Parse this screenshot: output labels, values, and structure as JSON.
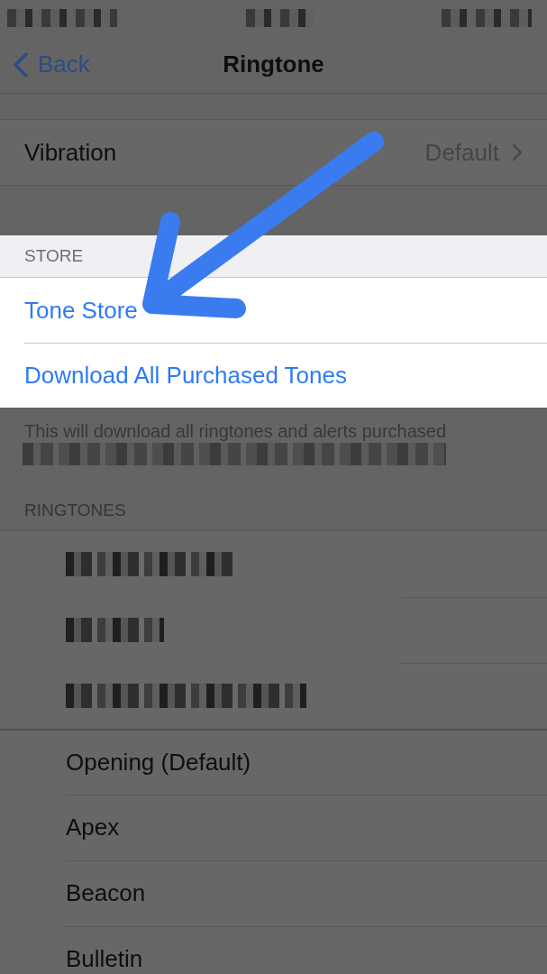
{
  "status_bar": [
    {
      "kind": "redacted"
    },
    {
      "kind": "redacted"
    },
    {
      "kind": "redacted"
    }
  ],
  "nav": {
    "back": "Back",
    "title": "Ringtone"
  },
  "vibration": {
    "label": "Vibration",
    "value": "Default"
  },
  "store": {
    "header": "STORE",
    "highlighted": true,
    "items": [
      "Tone Store",
      "Download All Purchased Tones"
    ]
  },
  "footer": [
    {
      "kind": "text",
      "text": "This will download all ringtones and alerts purchased"
    },
    {
      "kind": "redacted"
    }
  ],
  "ringtones": {
    "header": "RINGTONES",
    "items": [
      {
        "kind": "redacted"
      },
      {
        "kind": "redacted"
      },
      {
        "kind": "redacted"
      },
      {
        "kind": "tone",
        "name": "Opening (Default)"
      },
      {
        "kind": "tone",
        "name": "Apex"
      },
      {
        "kind": "tone",
        "name": "Beacon"
      },
      {
        "kind": "tone",
        "name": "Bulletin"
      }
    ]
  },
  "annotation": {
    "kind": "arrow"
  }
}
